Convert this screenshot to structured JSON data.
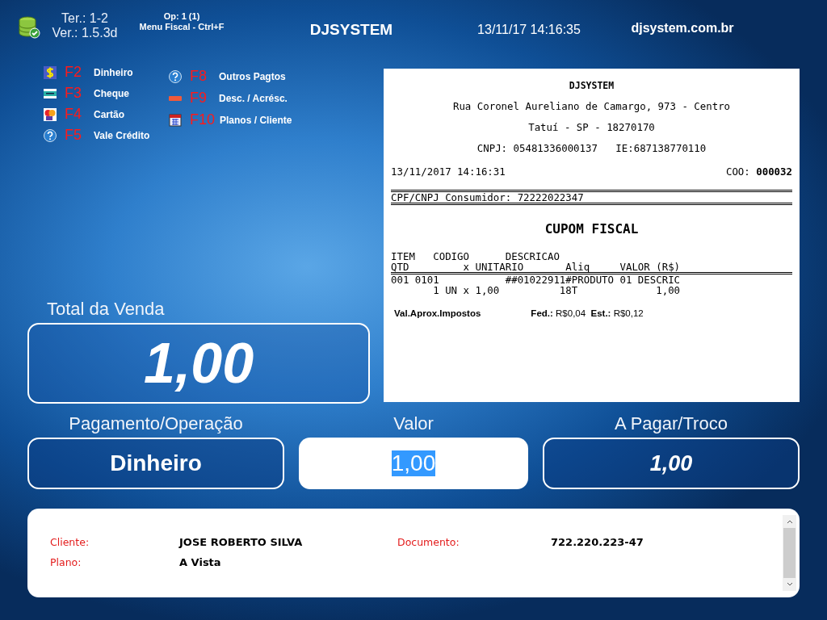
{
  "header": {
    "terminal": "Ter.: 1-2",
    "version": "Ver.: 1.5.3d",
    "operator": "Op: 1 (1)",
    "menu_hint": "Menu Fiscal - Ctrl+F",
    "title": "DJSYSTEM",
    "datetime": "13/11/17 14:16:35",
    "website": "djsystem.com.br"
  },
  "shortcuts": [
    {
      "kind": "cash",
      "key": "F2",
      "label": "Dinheiro"
    },
    {
      "kind": "cheque",
      "key": "F3",
      "label": "Cheque"
    },
    {
      "kind": "card",
      "key": "F4",
      "label": "Cartão"
    },
    {
      "kind": "help",
      "key": "F5",
      "label": "Vale Crédito"
    },
    {
      "kind": "help",
      "key": "F8",
      "label": "Outros Pagtos"
    },
    {
      "kind": "minus",
      "key": "F9",
      "label": "Desc. / Acrésc."
    },
    {
      "kind": "plans",
      "key": "F10",
      "label": "Planos / Cliente"
    }
  ],
  "receipt": {
    "company": "DJSYSTEM",
    "address": "Rua Coronel Aureliano de Camargo, 973 - Centro",
    "city": "Tatuí - SP - 18270170",
    "tax_ids": "CNPJ: 05481336000137   IE:687138770110",
    "datetime": "13/11/2017 14:16:31",
    "coo": "COO: **000032**",
    "consumer": "CPF/CNPJ Consumidor: 72222022347",
    "title": "CUPOM FISCAL",
    "header_lines": [
      "ITEM   CODIGO      DESCRICAO",
      "QTD         x UNITARIO       Aliq     VALOR (R$)"
    ],
    "item_lines": [
      "001 0101           ##01022911#PRODUTO 01 DESCRIC",
      "       1 UN x 1,00          18T             1,00"
    ],
    "tax_label": "Val.Aprox.Impostos",
    "tax_values": "**Fed.:** R$0,04  **Est.:** R$0,12"
  },
  "total": {
    "label": "Total da Venda",
    "value": "1,00"
  },
  "fields": [
    {
      "kind": "dark",
      "label": "Pagamento/Operação",
      "value": "Dinheiro",
      "highlighted": false
    },
    {
      "kind": "input",
      "label": "Valor",
      "value": "1,00",
      "highlighted": true
    },
    {
      "kind": "italic",
      "label": "A Pagar/Troco",
      "value": "1,00",
      "highlighted": false
    }
  ],
  "info": [
    {
      "label": "Cliente:",
      "value": "JOSE ROBERTO SILVA"
    },
    {
      "label": "Documento:",
      "value": "722.220.223-47"
    },
    {
      "label": "Plano:",
      "value": "A Vista"
    }
  ]
}
